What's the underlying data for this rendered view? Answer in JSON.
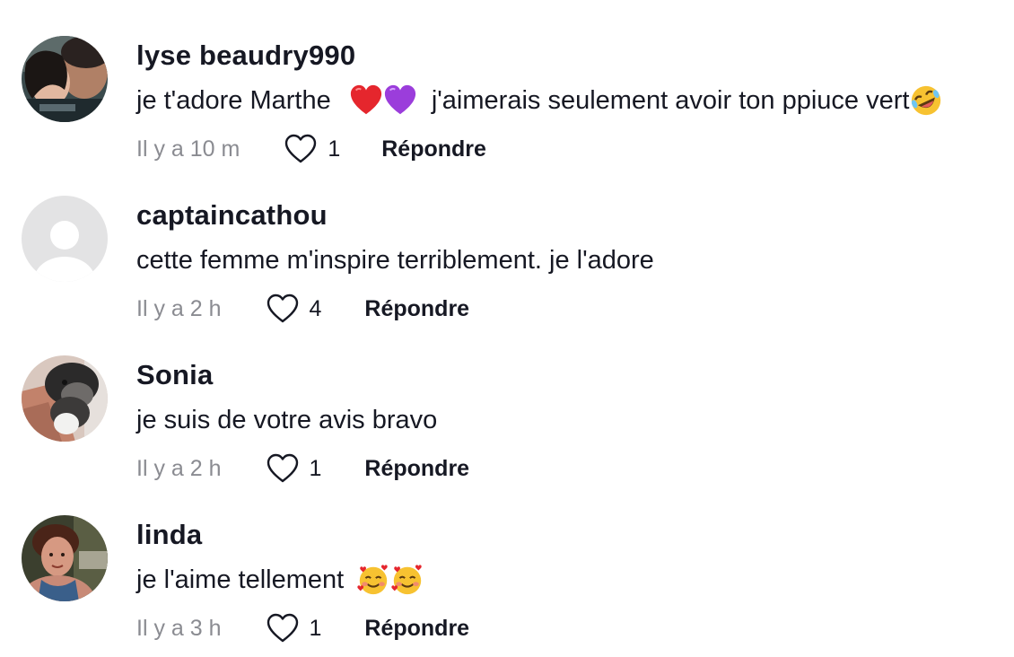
{
  "comments": [
    {
      "username": "lyse beaudry990",
      "text_before": "je t'adore Marthe ",
      "text_after": " j'aimerais seulement avoir ton ppiuce vert",
      "emojis_mid": [
        "red-heart",
        "purple-heart"
      ],
      "emoji_end": "rolling-on-floor-laughing",
      "time": "Il y a 10 m",
      "likes": "1",
      "reply": "Répondre"
    },
    {
      "username": "captaincathou",
      "text": "cette femme m'inspire terriblement. je l'adore",
      "time": "Il y a 2 h",
      "likes": "4",
      "reply": "Répondre"
    },
    {
      "username": "Sonia",
      "text": "je suis de votre avis bravo",
      "time": "Il y a 2 h",
      "likes": "1",
      "reply": "Répondre"
    },
    {
      "username": "linda",
      "text": "je l'aime tellement ",
      "emojis_end": [
        "smiling-face-with-hearts",
        "smiling-face-with-hearts"
      ],
      "time": "Il y a 3 h",
      "likes": "1",
      "reply": "Répondre"
    }
  ],
  "colors": {
    "text": "#161823",
    "secondary": "#8a8b91",
    "red_heart": "#e5262d",
    "purple_heart": "#9b3ddb"
  }
}
